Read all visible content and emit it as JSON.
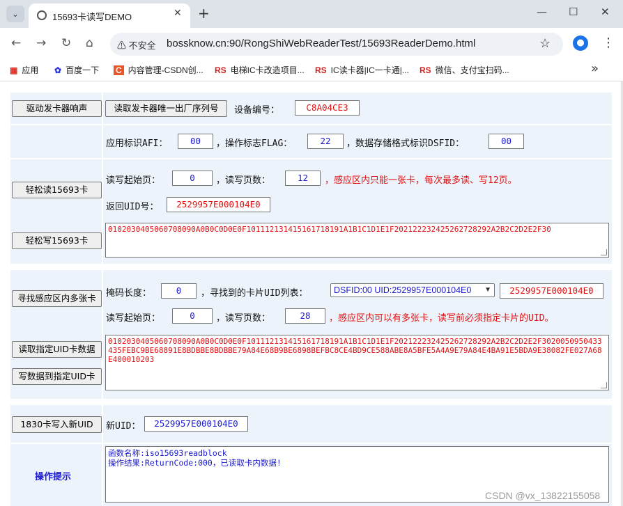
{
  "browser": {
    "tab_title": "15693卡读写DEMO",
    "insecure_label": "不安全",
    "url": "bossknow.cn:90/RongShiWebReaderTest/15693ReaderDemo.html",
    "bookmarks": [
      {
        "icon": "apps-icon",
        "label": "应用"
      },
      {
        "icon": "baidu-icon",
        "label": "百度一下"
      },
      {
        "icon": "csdn-icon",
        "label": "内容管理-CSDN创..."
      },
      {
        "icon": "rs-icon",
        "label": "电梯IC卡改造项目..."
      },
      {
        "icon": "rs-icon",
        "label": "IC读卡器|IC一卡通|..."
      },
      {
        "icon": "rs-icon",
        "label": "微信、支付宝扫码..."
      }
    ]
  },
  "row1": {
    "beep_button": "驱动发卡器响声",
    "serial_button": "读取发卡器唯一出厂序列号",
    "device_label": "设备编号：",
    "device_value": "C8A04CE3"
  },
  "row2": {
    "afi_label": "应用标识AFI：",
    "afi_value": "00",
    "flag_label": "，操作标志FLAG：",
    "flag_value": "22",
    "dsfid_label": "，数据存储格式标识DSFID：",
    "dsfid_value": "00"
  },
  "row3": {
    "read_button": "轻松读15693卡",
    "write_button": "轻松写15693卡",
    "start_label": "读写起始页：",
    "start_value": "0",
    "count_label": "，读写页数：",
    "count_value": "12",
    "note": "，感应区内只能一张卡，每次最多读、写12页。",
    "uid_label": "返回UID号：",
    "uid_value": "2529957E000104E0",
    "data": "0102030405060708090A0B0C0D0E0F101112131415161718191A1B1C1D1E1F202122232425262728292A2B2C2D2E2F30"
  },
  "row4": {
    "find_button": "寻找感应区内多张卡",
    "read_uid_button": "读取指定UID卡数据",
    "write_uid_button": "写数据到指定UID卡",
    "mask_label": "掩码长度：",
    "mask_value": "0",
    "list_label": "，寻找到的卡片UID列表：",
    "list_selected": "DSFID:00 UID:2529957E000104E0",
    "selected_uid": "2529957E000104E0",
    "start_label": "读写起始页：",
    "start_value": "0",
    "count_label": "，读写页数：",
    "count_value": "28",
    "note": "，感应区内可以有多张卡，读写前必须指定卡片的UID。",
    "data": "0102030405060708090A0B0C0D0E0F101112131415161718191A1B1C1D1E1F202122232425262728292A2B2C2D2E2F3020050950433435FEBC9BE68891E8BDBBE8BDBBE79A84E68B9BE6898BEFBC8CE4BD9CE588ABE8A5BFE5A4A9E79A84E4BA91E5BDA9E38082FE027A68E400010203"
  },
  "row5": {
    "new_uid_button": "1830卡写入新UID",
    "new_uid_label": "新UID：",
    "new_uid_value": "2529957E000104E0"
  },
  "row6": {
    "hint_label": "操作提示",
    "hint_text_line1": "函数名称:iso15693readblock",
    "hint_text_line2": "操作结果:ReturnCode:000，已读取卡内数据!"
  },
  "watermark": "CSDN @vx_13822155058",
  "colors": {
    "cell_bg": "#edf3fb",
    "value_blue": "#1b1bd0",
    "note_red": "#e01010"
  }
}
